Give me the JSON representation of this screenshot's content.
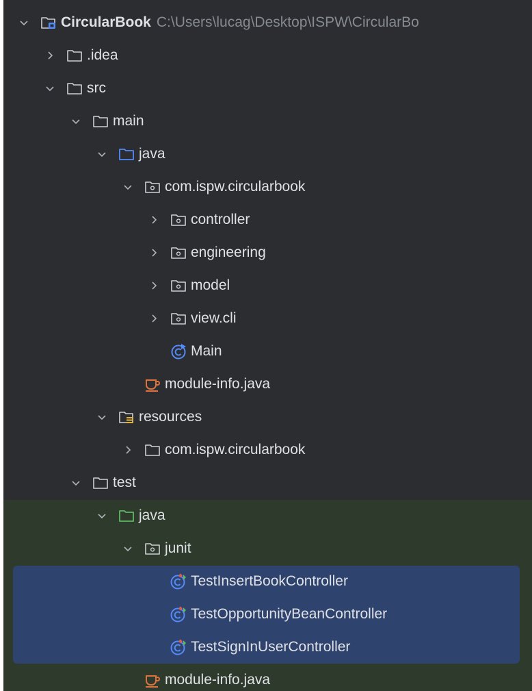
{
  "tree": {
    "project": {
      "label": "CircularBook",
      "path": "C:\\Users\\lucag\\Desktop\\ISPW\\CircularBo"
    },
    "rows": [
      {
        "label": ".idea",
        "expanded": false,
        "icon": "folder-icon"
      },
      {
        "label": "src",
        "expanded": true,
        "icon": "folder-icon"
      },
      {
        "label": "main",
        "expanded": true,
        "icon": "folder-icon"
      },
      {
        "label": "java",
        "expanded": true,
        "icon": "source-folder-icon"
      },
      {
        "label": "com.ispw.circularbook",
        "expanded": true,
        "icon": "package-icon"
      },
      {
        "label": "controller",
        "expanded": false,
        "icon": "package-icon"
      },
      {
        "label": "engineering",
        "expanded": false,
        "icon": "package-icon"
      },
      {
        "label": "model",
        "expanded": false,
        "icon": "package-icon"
      },
      {
        "label": "view.cli",
        "expanded": false,
        "icon": "package-icon"
      },
      {
        "label": "Main",
        "icon": "main-class-icon"
      },
      {
        "label": "module-info.java",
        "icon": "java-file-icon"
      },
      {
        "label": "resources",
        "expanded": true,
        "icon": "resources-folder-icon"
      },
      {
        "label": "com.ispw.circularbook",
        "expanded": false,
        "icon": "folder-icon"
      },
      {
        "label": "test",
        "expanded": true,
        "icon": "folder-icon"
      },
      {
        "label": "java",
        "expanded": true,
        "icon": "test-source-folder-icon"
      },
      {
        "label": "junit",
        "expanded": true,
        "icon": "package-icon"
      },
      {
        "label": "TestInsertBookController",
        "icon": "test-class-icon",
        "selected": true
      },
      {
        "label": "TestOpportunityBeanController",
        "icon": "test-class-icon",
        "selected": true
      },
      {
        "label": "TestSignInUserController",
        "icon": "test-class-icon",
        "selected": true
      },
      {
        "label": "module-info.java",
        "icon": "java-file-icon"
      }
    ]
  },
  "colors": {
    "background": "#2b2d30",
    "text": "#dfe1e5",
    "path_text": "#868a91",
    "test_region": "#2e3a2b",
    "selection": "#2e436e",
    "source_folder": "#548af7",
    "test_folder": "#5fb865",
    "java_file": "#e0733d"
  }
}
